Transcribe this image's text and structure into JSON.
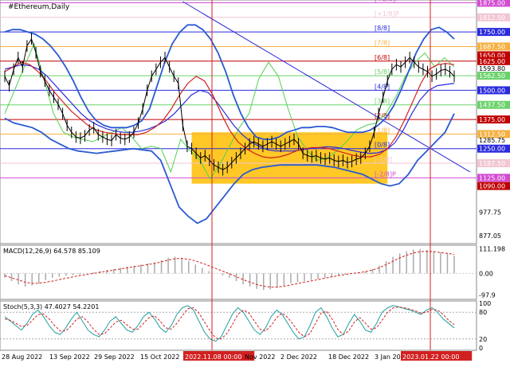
{
  "chart_data": [
    {
      "type": "line",
      "title": "#Ethereum,Daily",
      "x_labels": [
        "28 Aug 2022",
        "13 Sep 2022",
        "29 Sep 2022",
        "15 Oct 2022",
        "2022.11.08 00:00",
        "Nov 2022",
        "2 Dec 2022",
        "18 Dec 2022",
        "3 Jan 2023",
        "2023.01.22 00:00"
      ],
      "highlighted_x_labels": [
        "2022.11.08 00:00",
        "2023.01.22 00:00"
      ],
      "ylim": [
        850,
        1880
      ],
      "price_axis": [
        {
          "label": "1875.00",
          "value": 1875,
          "color": "#d24cd2"
        },
        {
          "label": "1812.50",
          "value": 1812.5,
          "color": "#f2c6d2"
        },
        {
          "label": "1750.00",
          "value": 1750,
          "color": "#2a2add"
        },
        {
          "label": "1687.50",
          "value": 1687.5,
          "color": "#f5b040"
        },
        {
          "label": "1650.00",
          "value": 1650,
          "color": "#c00000"
        },
        {
          "label": "1625.00",
          "value": 1625,
          "color": "#c00000"
        },
        {
          "label": "1593.80",
          "value": 1593.8,
          "color": ""
        },
        {
          "label": "1562.50",
          "value": 1562.5,
          "color": "#6bd26b"
        },
        {
          "label": "1500.00",
          "value": 1500,
          "color": "#2a2add"
        },
        {
          "label": "1437.50",
          "value": 1437.5,
          "color": "#6bd26b"
        },
        {
          "label": "1375.00",
          "value": 1375,
          "color": "#c00000"
        },
        {
          "label": "1312.50",
          "value": 1312.5,
          "color": "#f5b040"
        },
        {
          "label": "1285.75",
          "value": 1285.75,
          "color": ""
        },
        {
          "label": "1250.00",
          "value": 1250,
          "color": "#2a2add"
        },
        {
          "label": "1187.50",
          "value": 1187.5,
          "color": "#f2c6d2"
        },
        {
          "label": "1125.00",
          "value": 1125,
          "color": "#d24cd2"
        },
        {
          "label": "1090.00",
          "value": 1090,
          "color": "#c00000"
        },
        {
          "label": "977.75",
          "value": 977.75,
          "color": ""
        },
        {
          "label": "877.05",
          "value": 877.05,
          "color": ""
        }
      ],
      "murrey_levels": [
        {
          "label": "[+2/8]P",
          "value": 1875,
          "color": "#d24cd2"
        },
        {
          "label": "[+1/8]P",
          "value": 1812.5,
          "color": "#f2c6d2"
        },
        {
          "label": "[8/8]",
          "value": 1750,
          "color": "#2a2add"
        },
        {
          "label": "[7/8]",
          "value": 1687.5,
          "color": "#f5b040"
        },
        {
          "label": "[6/8]",
          "value": 1625,
          "color": "#c00000"
        },
        {
          "label": "[5/8]",
          "value": 1562.5,
          "color": "#6bd26b"
        },
        {
          "label": "[4/8]",
          "value": 1500,
          "color": "#2a2add"
        },
        {
          "label": "[3/8]",
          "value": 1437.5,
          "color": "#6bd26b"
        },
        {
          "label": "[2/8]",
          "value": 1375,
          "color": "#c00000"
        },
        {
          "label": "[1/8]",
          "value": 1312.5,
          "color": "#f5b040"
        },
        {
          "label": "[0/8]",
          "value": 1250,
          "color": "#2a2add"
        },
        {
          "label": "[-1/8]",
          "value": 1187.5,
          "color": "#f2c6d2"
        },
        {
          "label": "[-2/8]P",
          "value": 1125,
          "color": "#d24cd2"
        }
      ],
      "price_series": [
        1560,
        1520,
        1590,
        1640,
        1600,
        1690,
        1720,
        1660,
        1580,
        1540,
        1500,
        1470,
        1440,
        1400,
        1350,
        1320,
        1300,
        1295,
        1305,
        1330,
        1340,
        1310,
        1300,
        1290,
        1285,
        1310,
        1295,
        1290,
        1300,
        1320,
        1360,
        1420,
        1500,
        1560,
        1590,
        1620,
        1640,
        1600,
        1560,
        1530,
        1350,
        1260,
        1250,
        1230,
        1210,
        1220,
        1200,
        1180,
        1170,
        1160,
        1170,
        1190,
        1210,
        1230,
        1250,
        1270,
        1280,
        1270,
        1260,
        1270,
        1280,
        1270,
        1260,
        1270,
        1280,
        1290,
        1270,
        1230,
        1220,
        1215,
        1220,
        1210,
        1205,
        1210,
        1200,
        1195,
        1200,
        1190,
        1195,
        1205,
        1210,
        1230,
        1260,
        1320,
        1400,
        1470,
        1540,
        1590,
        1610,
        1600,
        1620,
        1640,
        1620,
        1600,
        1590,
        1580,
        1560,
        1570,
        1585,
        1590,
        1580,
        1560
      ],
      "bollinger_upper": [
        1750,
        1760,
        1760,
        1750,
        1740,
        1720,
        1690,
        1650,
        1600,
        1540,
        1470,
        1410,
        1370,
        1350,
        1340,
        1340,
        1340,
        1350,
        1370,
        1420,
        1520,
        1620,
        1700,
        1750,
        1780,
        1780,
        1760,
        1720,
        1660,
        1580,
        1480,
        1400,
        1340,
        1300,
        1290,
        1290,
        1300,
        1320,
        1330,
        1340,
        1340,
        1345,
        1345,
        1340,
        1330,
        1320,
        1320,
        1320,
        1330,
        1350,
        1380,
        1430,
        1500,
        1580,
        1660,
        1720,
        1760,
        1770,
        1750,
        1720
      ],
      "bollinger_lower": [
        1380,
        1360,
        1350,
        1340,
        1320,
        1290,
        1270,
        1250,
        1240,
        1235,
        1230,
        1235,
        1240,
        1245,
        1250,
        1245,
        1240,
        1200,
        1100,
        1000,
        960,
        930,
        950,
        1000,
        1050,
        1100,
        1140,
        1160,
        1170,
        1175,
        1180,
        1180,
        1180,
        1180,
        1180,
        1175,
        1170,
        1160,
        1150,
        1140,
        1120,
        1100,
        1090,
        1100,
        1140,
        1200,
        1240,
        1280,
        1320,
        1400
      ],
      "ma_red": [
        1580,
        1600,
        1620,
        1610,
        1580,
        1540,
        1490,
        1450,
        1410,
        1380,
        1350,
        1330,
        1320,
        1315,
        1310,
        1310,
        1310,
        1320,
        1340,
        1370,
        1420,
        1480,
        1530,
        1560,
        1540,
        1480,
        1400,
        1330,
        1280,
        1250,
        1230,
        1215,
        1210,
        1215,
        1225,
        1240,
        1250,
        1255,
        1255,
        1250,
        1240,
        1230,
        1220,
        1215,
        1215,
        1225,
        1250,
        1300,
        1370,
        1450,
        1530,
        1590,
        1610,
        1615,
        1610
      ],
      "ma_blue": [
        1590,
        1600,
        1610,
        1605,
        1590,
        1560,
        1520,
        1480,
        1440,
        1400,
        1370,
        1350,
        1335,
        1325,
        1320,
        1320,
        1325,
        1335,
        1350,
        1370,
        1400,
        1440,
        1480,
        1500,
        1490,
        1450,
        1400,
        1350,
        1310,
        1280,
        1260,
        1245,
        1240,
        1240,
        1240,
        1245,
        1250,
        1255,
        1258,
        1256,
        1250,
        1242,
        1235,
        1230,
        1232,
        1245,
        1275,
        1330,
        1400,
        1460,
        1500,
        1520,
        1525,
        1530
      ],
      "oscillator_green": [
        1400,
        1500,
        1600,
        1700,
        1550,
        1400,
        1320,
        1300,
        1290,
        1280,
        1300,
        1320,
        1340,
        1300,
        1250,
        1260,
        1250,
        1150,
        1290,
        1240,
        1200,
        1120,
        1180,
        1260,
        1340,
        1400,
        1550,
        1620,
        1560,
        1420,
        1300,
        1240,
        1200,
        1210,
        1240,
        1280,
        1330,
        1350,
        1360,
        1400,
        1470,
        1560,
        1620,
        1660,
        1600,
        1640,
        1600
      ],
      "trendline_blue": {
        "from": {
          "index": 40,
          "value": 1880
        },
        "to": {
          "index": 101,
          "value": 1150
        }
      },
      "consolidation_box": {
        "from_index": 42,
        "to_index": 86,
        "top": 1320,
        "bottom": 1100
      }
    },
    {
      "type": "bar",
      "title": "MACD(12,26,9) 64.578 85.109",
      "axis_labels": [
        "111.198",
        "0.00",
        "-97.9"
      ],
      "ylim": [
        -110,
        120
      ],
      "histogram": [
        -20,
        -35,
        -50,
        -60,
        -55,
        -45,
        -30,
        -20,
        -15,
        -10,
        -8,
        -5,
        0,
        5,
        10,
        15,
        20,
        25,
        30,
        35,
        40,
        45,
        50,
        60,
        70,
        75,
        70,
        55,
        40,
        25,
        10,
        0,
        -10,
        -20,
        -35,
        -50,
        -60,
        -70,
        -75,
        -72,
        -65,
        -55,
        -45,
        -40,
        -35,
        -30,
        -25,
        -20,
        -15,
        -10,
        -5,
        0,
        5,
        10,
        20,
        35,
        55,
        75,
        90,
        100,
        108,
        110,
        105,
        100,
        95,
        90,
        80
      ],
      "signal": [
        -10,
        -20,
        -30,
        -40,
        -45,
        -45,
        -40,
        -35,
        -28,
        -22,
        -16,
        -10,
        -5,
        0,
        5,
        10,
        15,
        20,
        25,
        30,
        35,
        40,
        45,
        52,
        60,
        66,
        68,
        64,
        56,
        46,
        34,
        22,
        10,
        -2,
        -15,
        -28,
        -40,
        -50,
        -58,
        -62,
        -62,
        -58,
        -52,
        -46,
        -40,
        -34,
        -28,
        -22,
        -16,
        -10,
        -5,
        0,
        3,
        8,
        15,
        25,
        40,
        55,
        70,
        82,
        92,
        98,
        100,
        98,
        94,
        90,
        86
      ]
    },
    {
      "type": "line",
      "title": "Stoch(5,3,3) 47.4027 54.2201",
      "axis_labels": [
        "100",
        "80",
        "20",
        "0"
      ],
      "ylim": [
        0,
        100
      ],
      "levels": [
        80,
        20
      ],
      "main": [
        70,
        60,
        50,
        40,
        55,
        75,
        85,
        70,
        50,
        35,
        30,
        45,
        65,
        80,
        60,
        40,
        30,
        25,
        40,
        60,
        70,
        55,
        40,
        35,
        50,
        70,
        80,
        65,
        45,
        35,
        50,
        75,
        90,
        95,
        85,
        60,
        35,
        20,
        15,
        25,
        50,
        75,
        90,
        80,
        60,
        40,
        30,
        45,
        70,
        85,
        75,
        55,
        35,
        20,
        25,
        50,
        80,
        90,
        70,
        45,
        25,
        30,
        55,
        75,
        60,
        40,
        35,
        55,
        80,
        90,
        95,
        92,
        88,
        85,
        80,
        75,
        85,
        90,
        80,
        65,
        55,
        45
      ],
      "signal": [
        65,
        62,
        55,
        48,
        50,
        62,
        75,
        76,
        65,
        50,
        38,
        38,
        50,
        65,
        70,
        58,
        42,
        30,
        32,
        45,
        58,
        62,
        52,
        42,
        42,
        55,
        68,
        72,
        60,
        45,
        42,
        55,
        72,
        88,
        90,
        78,
        58,
        38,
        22,
        20,
        32,
        52,
        75,
        85,
        78,
        60,
        42,
        38,
        50,
        68,
        78,
        68,
        52,
        35,
        25,
        32,
        55,
        78,
        82,
        65,
        42,
        30,
        38,
        58,
        68,
        55,
        42,
        45,
        62,
        80,
        90,
        92,
        90,
        87,
        83,
        78,
        80,
        86,
        85,
        75,
        62,
        52
      ]
    }
  ]
}
